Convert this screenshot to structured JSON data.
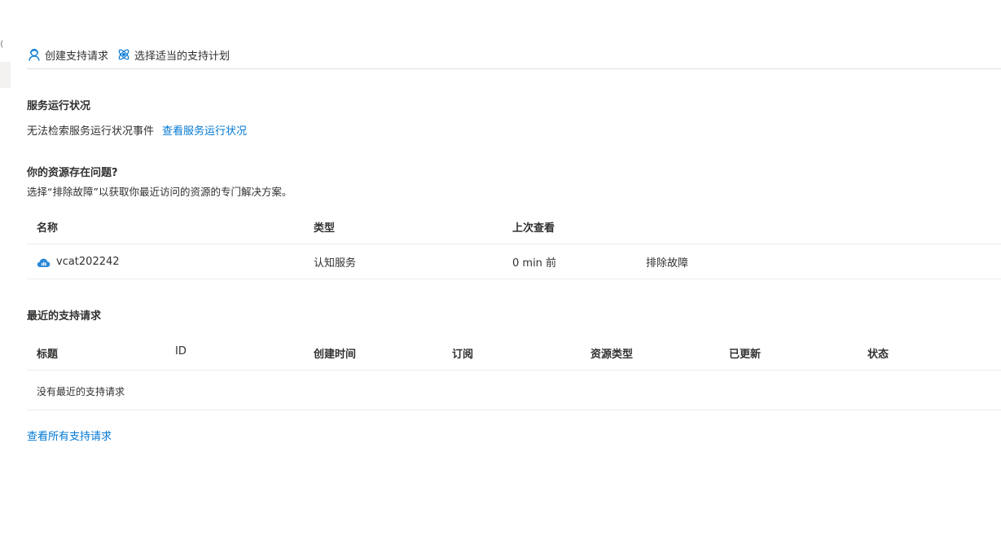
{
  "toolbar": {
    "create_request": {
      "label": "创建支持请求",
      "icon": "support-agent-icon"
    },
    "choose_plan": {
      "label": "选择适当的支持计划",
      "icon": "atom-plan-icon"
    }
  },
  "service_health": {
    "title": "服务运行状况",
    "message": "无法检索服务运行状况事件",
    "link": "查看服务运行状况"
  },
  "resource_issues": {
    "title": "你的资源存在问题?",
    "subtitle": "选择“排除故障”以获取你最近访问的资源的专门解决方案。",
    "columns": [
      "名称",
      "类型",
      "上次查看"
    ],
    "rows": [
      {
        "name": "vcat202242",
        "icon": "cloud-cognitive-icon",
        "type": "认知服务",
        "last_viewed": "0 min 前",
        "action": "排除故障"
      }
    ]
  },
  "recent_requests": {
    "title": "最近的支持请求",
    "columns": [
      "标题",
      "ID",
      "创建时间",
      "订阅",
      "资源类型",
      "已更新",
      "状态"
    ],
    "empty_message": "没有最近的支持请求",
    "view_all_link": "查看所有支持请求"
  },
  "colors": {
    "link": "#0078d4",
    "text": "#323130",
    "divider": "#edebe9"
  }
}
